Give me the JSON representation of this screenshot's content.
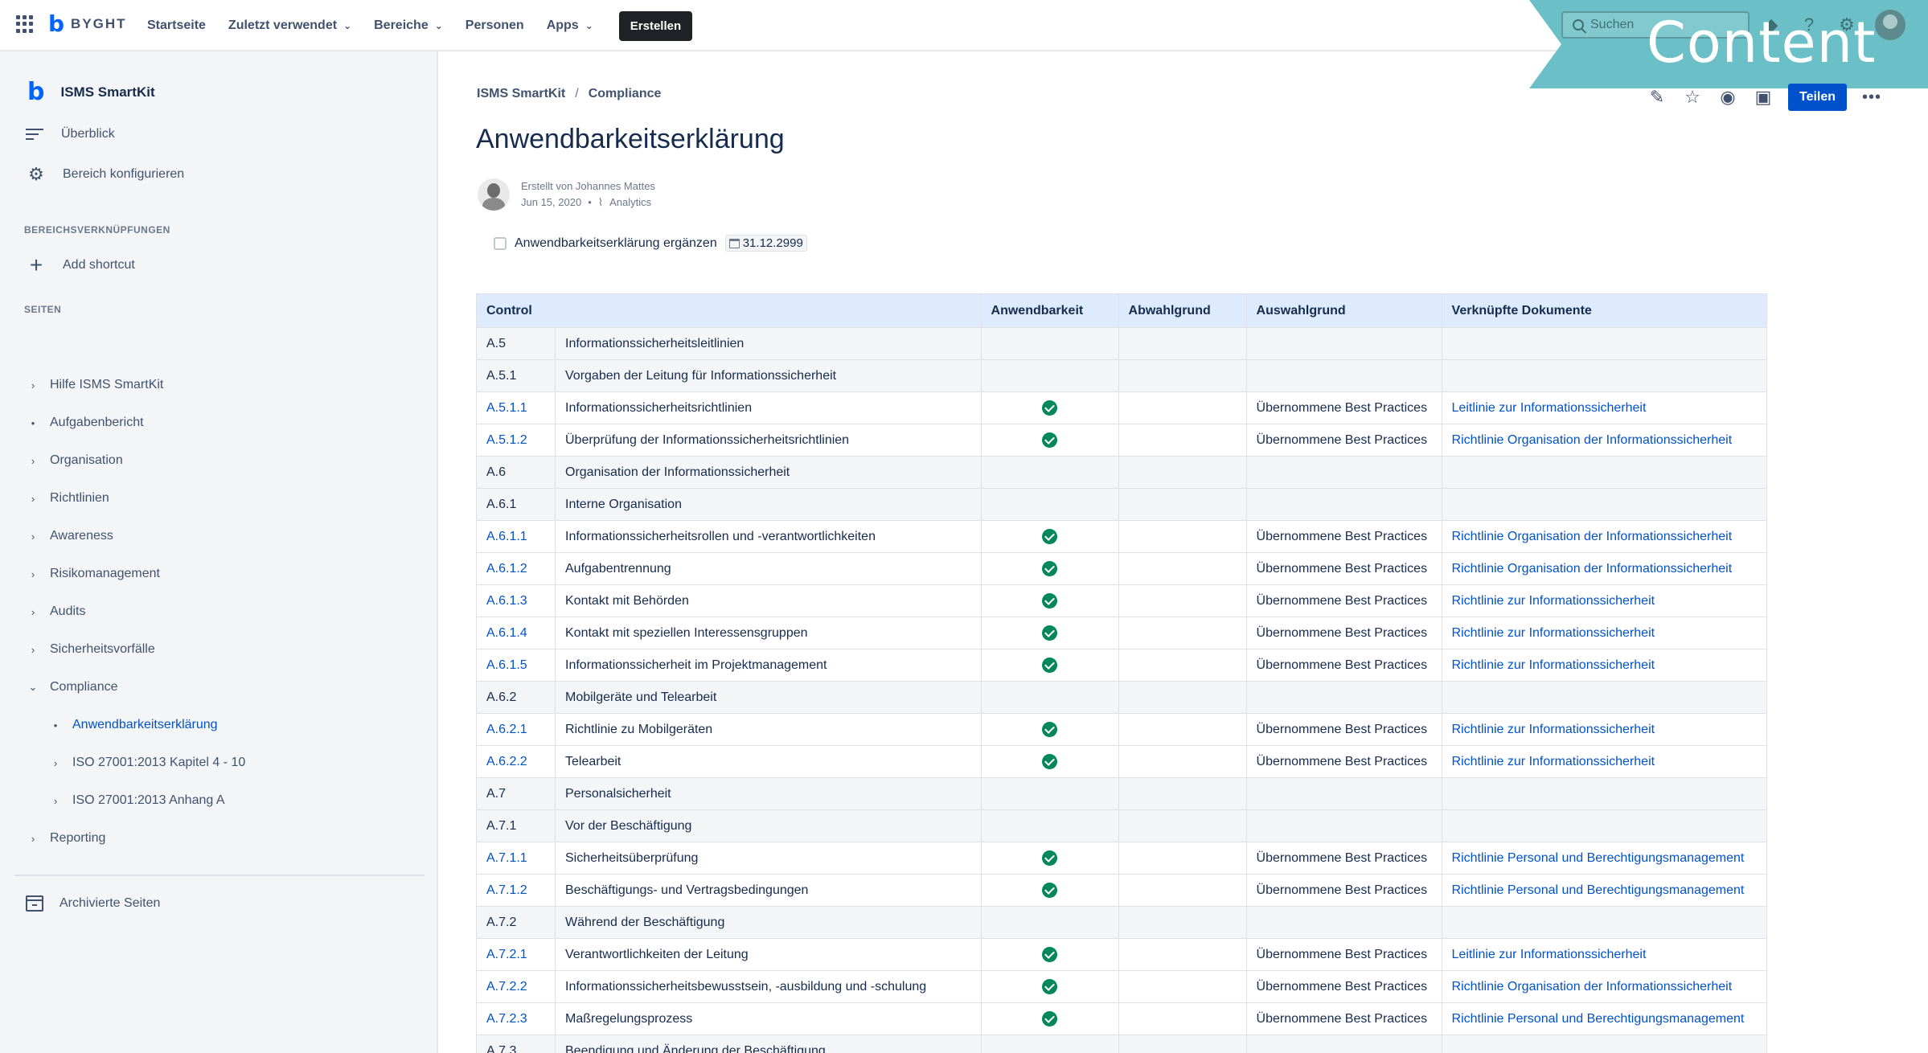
{
  "topnav": {
    "logo_text": "BYGHT",
    "items": [
      {
        "label": "Startseite",
        "dropdown": false
      },
      {
        "label": "Zuletzt verwendet",
        "dropdown": true
      },
      {
        "label": "Bereiche",
        "dropdown": true
      },
      {
        "label": "Personen",
        "dropdown": false
      },
      {
        "label": "Apps",
        "dropdown": true
      }
    ],
    "create_label": "Erstellen",
    "search_placeholder": "Suchen",
    "banner_text": "Content"
  },
  "sidebar": {
    "space_name": "ISMS SmartKit",
    "overview_label": "Überblick",
    "configure_label": "Bereich konfigurieren",
    "shortcuts_heading": "BEREICHSVERKNÜPFUNGEN",
    "add_shortcut_label": "Add shortcut",
    "pages_heading": "SEITEN",
    "tree": [
      {
        "label": "Hilfe ISMS SmartKit",
        "toggle": "›",
        "level": 0
      },
      {
        "label": "Aufgabenbericht",
        "toggle": "•",
        "level": 0
      },
      {
        "label": "Organisation",
        "toggle": "›",
        "level": 0
      },
      {
        "label": "Richtlinien",
        "toggle": "›",
        "level": 0
      },
      {
        "label": "Awareness",
        "toggle": "›",
        "level": 0
      },
      {
        "label": "Risikomanagement",
        "toggle": "›",
        "level": 0
      },
      {
        "label": "Audits",
        "toggle": "›",
        "level": 0
      },
      {
        "label": "Sicherheitsvorfälle",
        "toggle": "›",
        "level": 0
      },
      {
        "label": "Compliance",
        "toggle": "⌄",
        "level": 0
      },
      {
        "label": "Anwendbarkeitserklärung",
        "toggle": "•",
        "level": 1,
        "active": true
      },
      {
        "label": "ISO 27001:2013 Kapitel 4 - 10",
        "toggle": "›",
        "level": 1
      },
      {
        "label": "ISO 27001:2013 Anhang A",
        "toggle": "›",
        "level": 1
      },
      {
        "label": "Reporting",
        "toggle": "›",
        "level": 0
      }
    ],
    "archived_label": "Archivierte Seiten"
  },
  "page": {
    "breadcrumb": [
      "ISMS SmartKit",
      "Compliance"
    ],
    "share_label": "Teilen",
    "title": "Anwendbarkeitserklärung",
    "byline_created": "Erstellt von Johannes Mattes",
    "byline_date": "Jun 15, 2020",
    "byline_analytics": "Analytics",
    "task_label": "Anwendbarkeitserklärung ergänzen",
    "task_date": "31.12.2999"
  },
  "table": {
    "headers": [
      "Control",
      "",
      "Anwendbarkeit",
      "Abwahlgrund",
      "Auswahlgrund",
      "Verknüpfte Dokumente"
    ],
    "rows": [
      {
        "code": "A.5",
        "name": "Informationssicherheitsleitlinien",
        "group": true,
        "applicable": false,
        "reason": "",
        "doc": ""
      },
      {
        "code": "A.5.1",
        "name": "Vorgaben der Leitung für Informationssicherheit",
        "group": true,
        "applicable": false,
        "reason": "",
        "doc": ""
      },
      {
        "code": "A.5.1.1",
        "name": "Informationssicherheitsrichtlinien",
        "group": false,
        "applicable": true,
        "reason": "Übernommene Best Practices",
        "doc": "Leitlinie zur Informationssicherheit"
      },
      {
        "code": "A.5.1.2",
        "name": "Überprüfung der Informationssicherheitsrichtlinien",
        "group": false,
        "applicable": true,
        "reason": "Übernommene Best Practices",
        "doc": "Richtlinie Organisation der Informationssicherheit"
      },
      {
        "code": "A.6",
        "name": "Organisation der Informationssicherheit",
        "group": true,
        "applicable": false,
        "reason": "",
        "doc": ""
      },
      {
        "code": "A.6.1",
        "name": "Interne Organisation",
        "group": true,
        "applicable": false,
        "reason": "",
        "doc": ""
      },
      {
        "code": "A.6.1.1",
        "name": "Informationssicherheitsrollen und -verantwortlichkeiten",
        "group": false,
        "applicable": true,
        "reason": "Übernommene Best Practices",
        "doc": "Richtlinie Organisation der Informationssicherheit"
      },
      {
        "code": "A.6.1.2",
        "name": "Aufgabentrennung",
        "group": false,
        "applicable": true,
        "reason": "Übernommene Best Practices",
        "doc": "Richtlinie Organisation der Informationssicherheit"
      },
      {
        "code": "A.6.1.3",
        "name": "Kontakt mit Behörden",
        "group": false,
        "applicable": true,
        "reason": "Übernommene Best Practices",
        "doc": "Richtlinie zur Informationssicherheit"
      },
      {
        "code": "A.6.1.4",
        "name": "Kontakt mit speziellen Interessensgruppen",
        "group": false,
        "applicable": true,
        "reason": "Übernommene Best Practices",
        "doc": "Richtlinie zur Informationssicherheit"
      },
      {
        "code": "A.6.1.5",
        "name": "Informationssicherheit im Projektmanagement",
        "group": false,
        "applicable": true,
        "reason": "Übernommene Best Practices",
        "doc": "Richtlinie zur Informationssicherheit"
      },
      {
        "code": "A.6.2",
        "name": "Mobilgeräte und Telearbeit",
        "group": true,
        "applicable": false,
        "reason": "",
        "doc": ""
      },
      {
        "code": "A.6.2.1",
        "name": "Richtlinie zu Mobilgeräten",
        "group": false,
        "applicable": true,
        "reason": "Übernommene Best Practices",
        "doc": "Richtlinie zur Informationssicherheit"
      },
      {
        "code": "A.6.2.2",
        "name": "Telearbeit",
        "group": false,
        "applicable": true,
        "reason": "Übernommene Best Practices",
        "doc": "Richtlinie zur Informationssicherheit"
      },
      {
        "code": "A.7",
        "name": "Personalsicherheit",
        "group": true,
        "applicable": false,
        "reason": "",
        "doc": ""
      },
      {
        "code": "A.7.1",
        "name": "Vor der Beschäftigung",
        "group": true,
        "applicable": false,
        "reason": "",
        "doc": ""
      },
      {
        "code": "A.7.1.1",
        "name": "Sicherheitsüberprüfung",
        "group": false,
        "applicable": true,
        "reason": "Übernommene Best Practices",
        "doc": "Richtlinie Personal und Berechtigungsmanagement"
      },
      {
        "code": "A.7.1.2",
        "name": "Beschäftigungs- und Vertragsbedingungen",
        "group": false,
        "applicable": true,
        "reason": "Übernommene Best Practices",
        "doc": "Richtlinie Personal und Berechtigungsmanagement"
      },
      {
        "code": "A.7.2",
        "name": "Während der Beschäftigung",
        "group": true,
        "applicable": false,
        "reason": "",
        "doc": ""
      },
      {
        "code": "A.7.2.1",
        "name": "Verantwortlichkeiten der Leitung",
        "group": false,
        "applicable": true,
        "reason": "Übernommene Best Practices",
        "doc": "Leitlinie zur Informationssicherheit"
      },
      {
        "code": "A.7.2.2",
        "name": "Informationssicherheitsbewusstsein, -ausbildung und -schulung",
        "group": false,
        "applicable": true,
        "reason": "Übernommene Best Practices",
        "doc": "Richtlinie Organisation der Informationssicherheit"
      },
      {
        "code": "A.7.2.3",
        "name": "Maßregelungsprozess",
        "group": false,
        "applicable": true,
        "reason": "Übernommene Best Practices",
        "doc": "Richtlinie Personal und Berechtigungsmanagement"
      },
      {
        "code": "A.7.3",
        "name": "Beendigung und Änderung der Beschäftigung",
        "group": true,
        "applicable": false,
        "reason": "",
        "doc": ""
      }
    ]
  },
  "colors": {
    "accent": "#0052cc",
    "header_bg": "#deebff",
    "check": "#00875a",
    "banner": "#6bc0c7"
  }
}
